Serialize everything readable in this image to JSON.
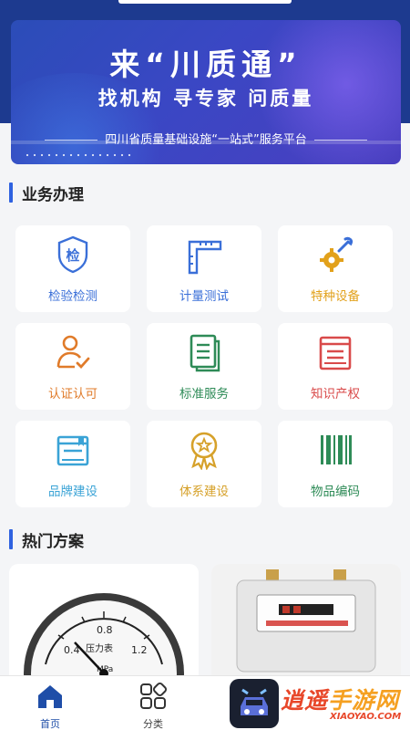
{
  "banner": {
    "title": "来“川质通”",
    "subtitle": "找机构 寻专家 问质量",
    "tagline": "四川省质量基础设施“一站式”服务平台"
  },
  "sections": {
    "business": "业务办理",
    "hot": "热门方案"
  },
  "services": [
    {
      "label": "检验检测",
      "icon": "inspection-shield-icon",
      "color": "#3a6fd8"
    },
    {
      "label": "计量测试",
      "icon": "measuring-square-icon",
      "color": "#3a6fd8"
    },
    {
      "label": "特种设备",
      "icon": "gear-wrench-icon",
      "color": "#e2a11b"
    },
    {
      "label": "认证认可",
      "icon": "user-check-icon",
      "color": "#e07b2a"
    },
    {
      "label": "标准服务",
      "icon": "document-icon",
      "color": "#2e8b57"
    },
    {
      "label": "知识产权",
      "icon": "book-icon",
      "color": "#d94a4a"
    },
    {
      "label": "品牌建设",
      "icon": "brand-book-icon",
      "color": "#3aa3d6"
    },
    {
      "label": "体系建设",
      "icon": "award-badge-icon",
      "color": "#d6a12a"
    },
    {
      "label": "物品编码",
      "icon": "barcode-icon",
      "color": "#2e8b57"
    }
  ],
  "gauge": {
    "ticks": [
      "0.4",
      "0.8",
      "1.2"
    ],
    "caption": "压力表",
    "unit": "MPa"
  },
  "tabs": [
    {
      "label": "首页",
      "icon": "home-icon",
      "active": true
    },
    {
      "label": "分类",
      "icon": "category-grid-icon",
      "active": false
    }
  ],
  "watermark": {
    "text1": "逍遥",
    "text2": "手游网",
    "url": "XIAOYAO.COM"
  },
  "colors": {
    "primary": "#2f62e0",
    "banner": "#3a47c4",
    "nav_active": "#1f4ea8"
  }
}
